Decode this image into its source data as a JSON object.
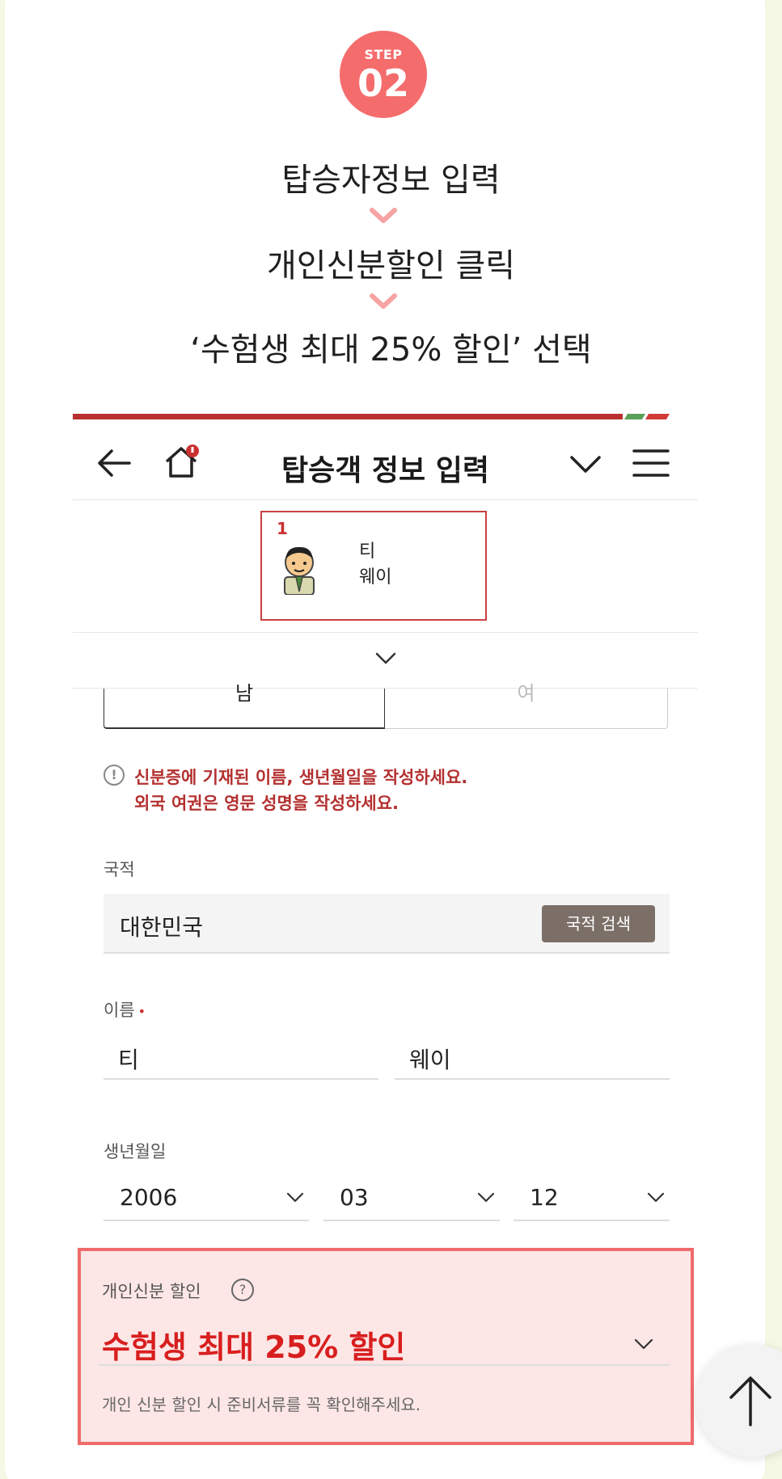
{
  "step": {
    "label": "STEP",
    "number": "02"
  },
  "instructions": {
    "line1": "탑승자정보 입력",
    "line2": "개인신분할인 클릭",
    "line3": "‘수험생 최대 25% 할인’ 선택"
  },
  "header": {
    "title": "탑승객 정보 입력",
    "back_icon": "back-arrow-icon",
    "home_icon": "home-icon",
    "dropdown_icon": "chevron-down-icon",
    "menu_icon": "hamburger-menu-icon"
  },
  "passenger": {
    "index": "1",
    "first_name": "티",
    "last_name": "웨이"
  },
  "gender": {
    "male": "남",
    "female": "여"
  },
  "notice": {
    "line1": "신분증에 기재된 이름, 생년월일을 작성하세요.",
    "line2": "외국 여권은 영문 성명을 작성하세요."
  },
  "nationality": {
    "label": "국적",
    "value": "대한민국",
    "search_button": "국적 검색"
  },
  "name": {
    "label": "이름",
    "required_mark": "•",
    "first": "티",
    "last": "웨이"
  },
  "birth": {
    "label": "생년월일",
    "year": "2006",
    "month": "03",
    "day": "12"
  },
  "discount": {
    "label": "개인신분 할인",
    "help_icon": "?",
    "value": "수험생 최대 25% 할인",
    "hint": "개인 신분 할인 시 준비서류를 꼭 확인해주세요."
  },
  "colors": {
    "accent": "#f46c6c",
    "brand_red": "#b8302f",
    "highlight_bg": "#fde6e6",
    "discount_text": "#d81e1e"
  }
}
